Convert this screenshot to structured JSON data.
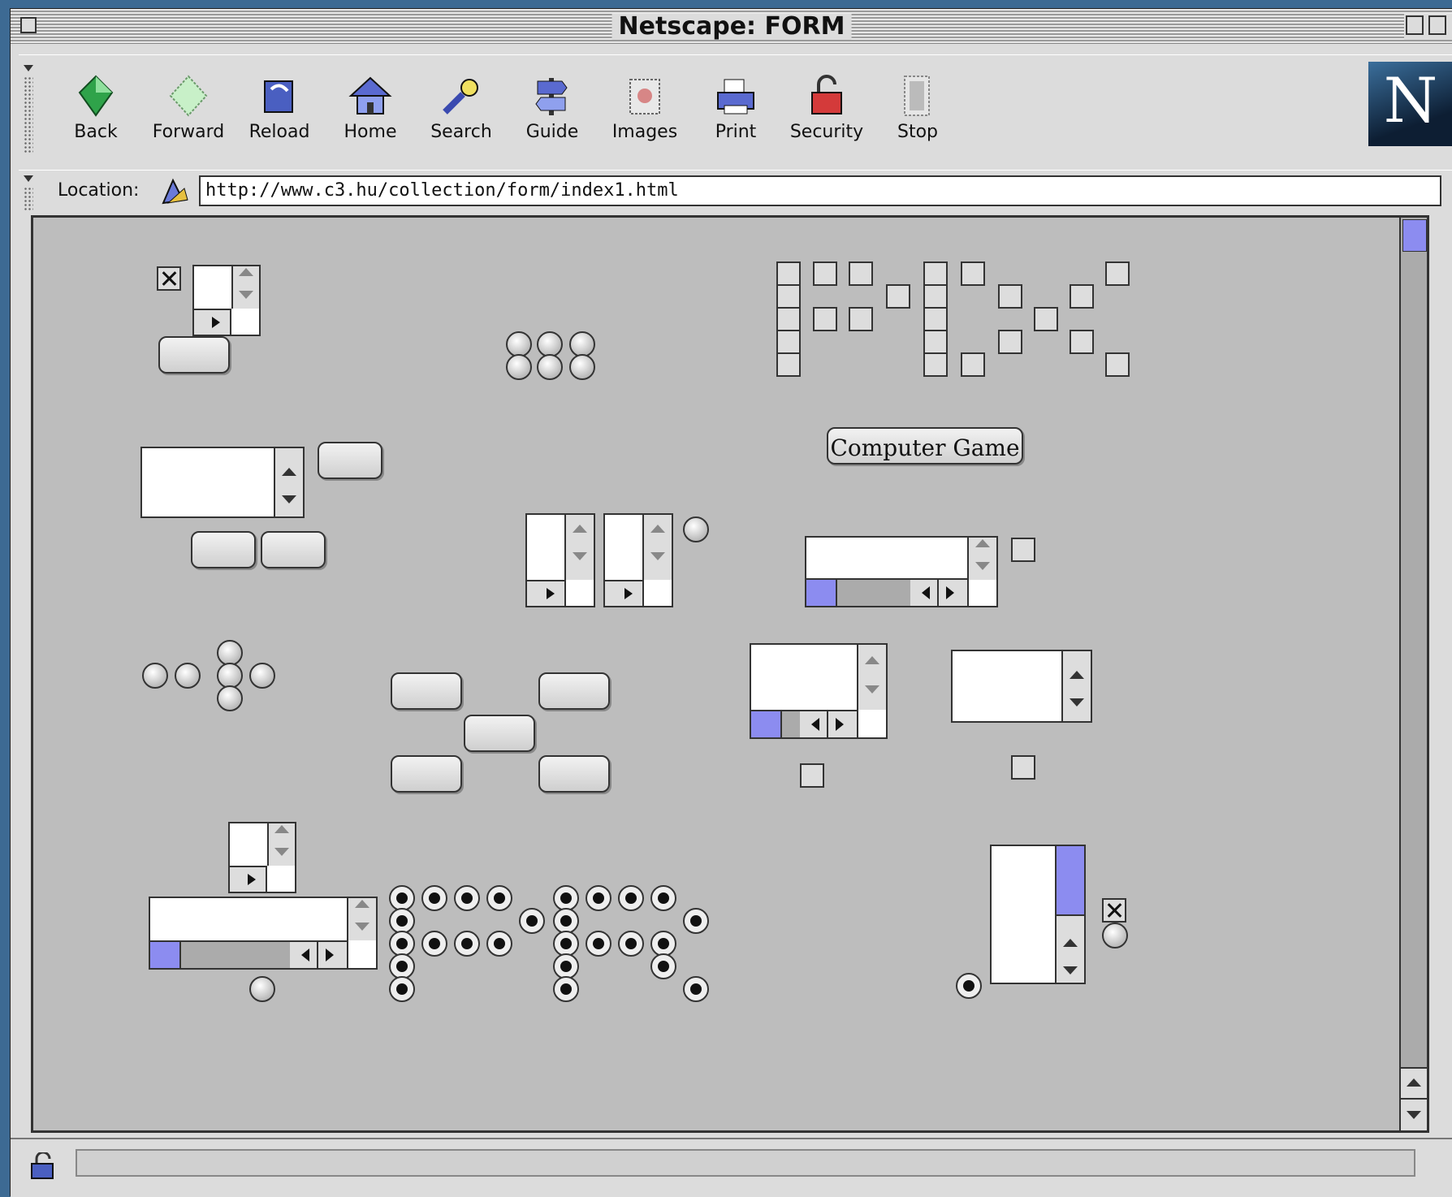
{
  "window": {
    "title": "Netscape: FORM"
  },
  "toolbar": {
    "buttons": [
      {
        "label": "Back",
        "icon": "back-icon"
      },
      {
        "label": "Forward",
        "icon": "forward-icon"
      },
      {
        "label": "Reload",
        "icon": "reload-icon"
      },
      {
        "label": "Home",
        "icon": "home-icon"
      },
      {
        "label": "Search",
        "icon": "search-icon"
      },
      {
        "label": "Guide",
        "icon": "guide-icon"
      },
      {
        "label": "Images",
        "icon": "images-icon"
      },
      {
        "label": "Print",
        "icon": "print-icon"
      },
      {
        "label": "Security",
        "icon": "security-icon"
      },
      {
        "label": "Stop",
        "icon": "stop-icon"
      }
    ],
    "logo_letter": "N"
  },
  "location": {
    "label": "Location:",
    "url": "http://www.c3.hu/collection/form/index1.html"
  },
  "page": {
    "computer_game_button": "Computer Game"
  },
  "colors": {
    "page_bg": "#bdbdbd",
    "scroll_thumb": "#8c8cf0",
    "chrome": "#dcdcdc"
  }
}
